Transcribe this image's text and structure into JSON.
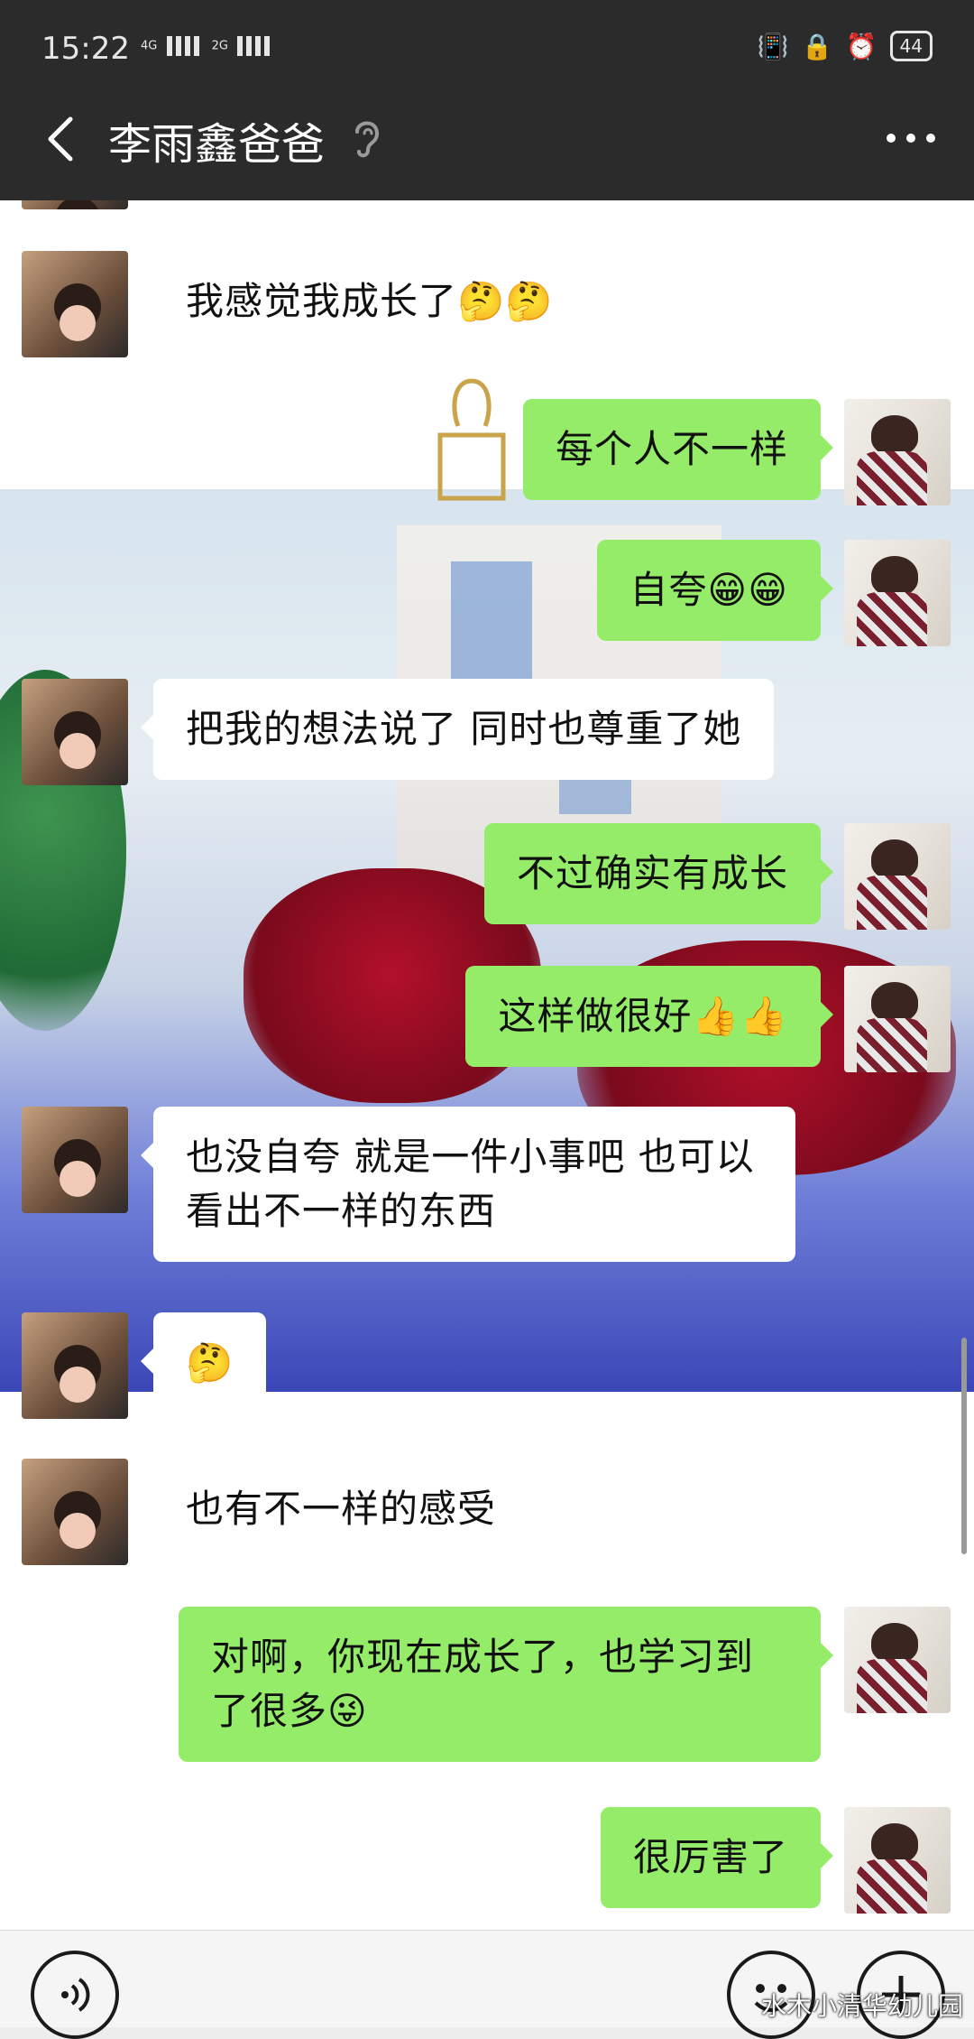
{
  "status_bar": {
    "time": "15:22",
    "network_1": "4G",
    "network_2": "2G",
    "battery": "44"
  },
  "header": {
    "title": "李雨鑫爸爸"
  },
  "messages": [
    {
      "side": "left",
      "avatar": "child",
      "text": "我感觉我成长了🤔🤔"
    },
    {
      "side": "right",
      "avatar": "teacher",
      "text": "每个人不一样"
    },
    {
      "side": "right",
      "avatar": "teacher",
      "text": "自夸😁😁"
    },
    {
      "side": "left",
      "avatar": "child",
      "text": "把我的想法说了 同时也尊重了她"
    },
    {
      "side": "right",
      "avatar": "teacher",
      "text": "不过确实有成长"
    },
    {
      "side": "right",
      "avatar": "teacher",
      "text": "这样做很好👍👍"
    },
    {
      "side": "left",
      "avatar": "child",
      "text": "也没自夸 就是一件小事吧 也可以看出不一样的东西"
    },
    {
      "side": "left",
      "avatar": "child",
      "text": "🤔"
    },
    {
      "side": "left",
      "avatar": "child",
      "text": "也有不一样的感受"
    },
    {
      "side": "right",
      "avatar": "teacher",
      "text": "对啊，你现在成长了，也学习到了很多😜"
    },
    {
      "side": "right",
      "avatar": "teacher",
      "text": "很厉害了"
    }
  ],
  "watermark": "水木小清华幼儿园",
  "colors": {
    "header_bg": "#2b2b2b",
    "right_bubble": "#95ec69",
    "left_bubble": "#ffffff"
  }
}
